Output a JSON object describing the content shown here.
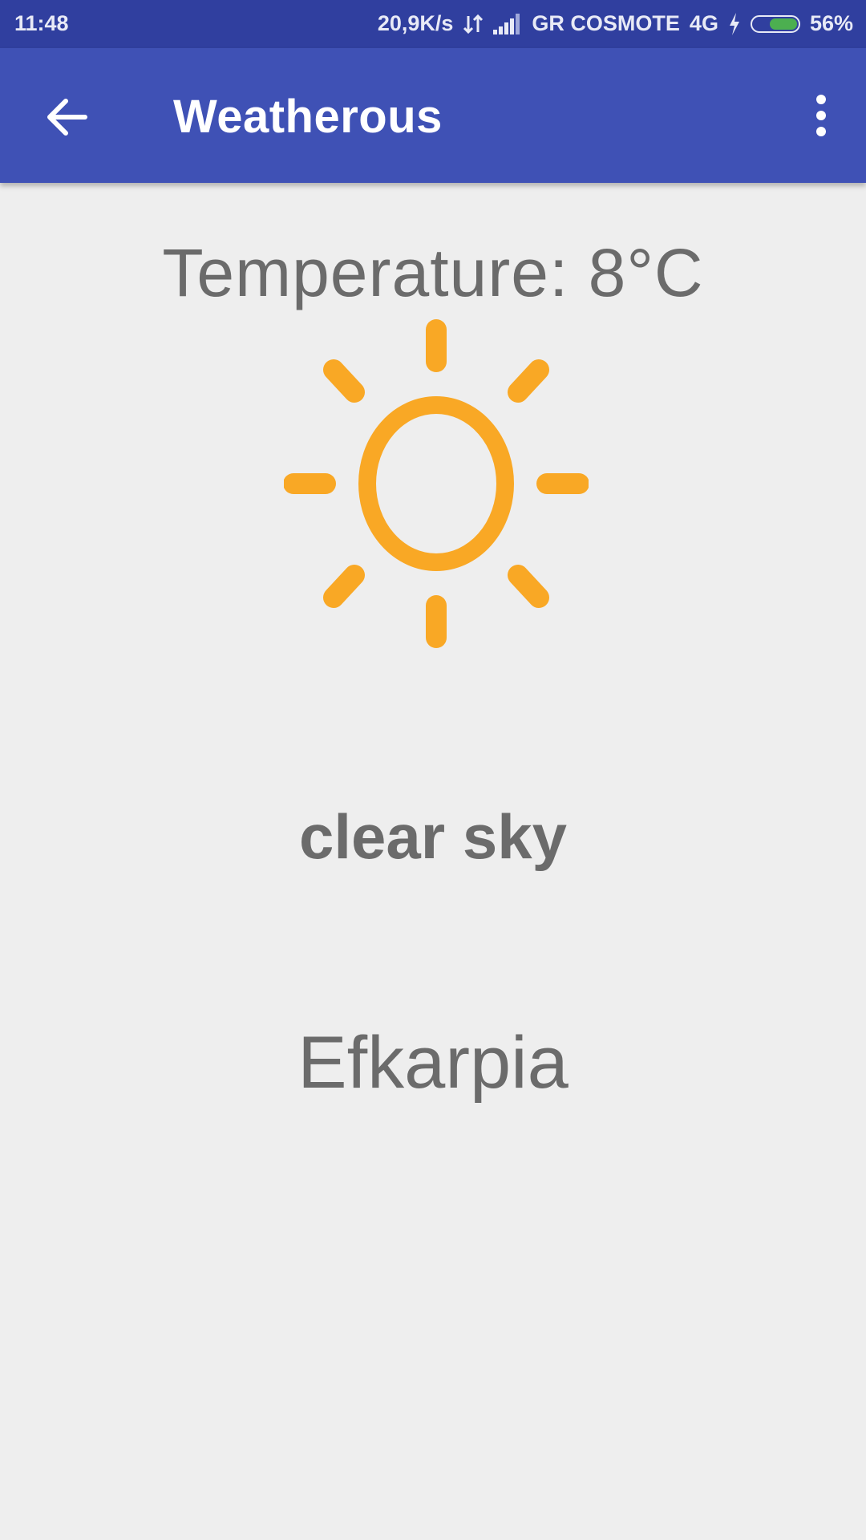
{
  "status_bar": {
    "time": "11:48",
    "speed": "20,9K/s",
    "carrier": "GR COSMOTE",
    "network": "4G",
    "battery": "56%",
    "battery_level": 0.56
  },
  "app_bar": {
    "title": "Weatherous",
    "back_icon": "arrow-back-icon",
    "menu_icon": "more-vert-icon"
  },
  "weather": {
    "temperature": "Temperature: 8°C",
    "icon": "sun-icon",
    "description": "clear sky",
    "city": "Efkarpia"
  },
  "colors": {
    "status_bar": "#303f9f",
    "app_bar": "#3f51b5",
    "background": "#eeeeee",
    "text": "#6b6b6b",
    "sun": "#f9a825"
  }
}
